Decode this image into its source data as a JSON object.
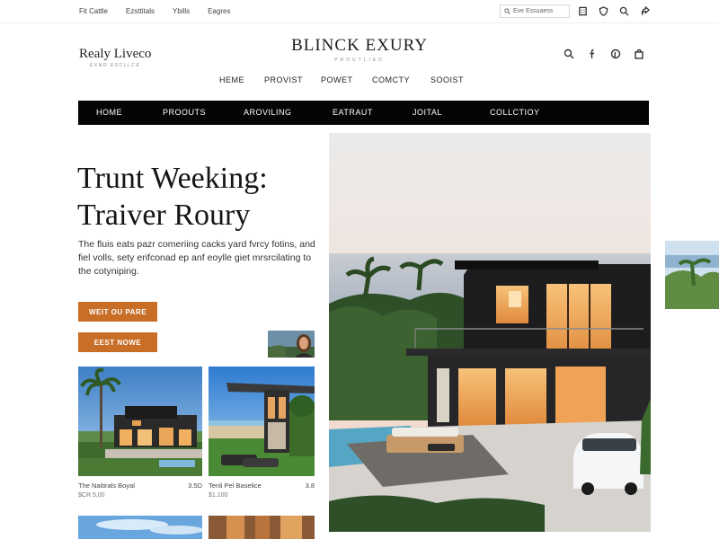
{
  "utility": {
    "links": [
      "Fit Cattle",
      "Ezsttitals",
      "Ybills",
      "Eagres"
    ],
    "search_placeholder": "Eve Essuaess"
  },
  "logo_left": {
    "name": "Realy Liveco",
    "sub": "EXNO ESCLLCE"
  },
  "brand": {
    "title": "BLINCK EXURY",
    "sub": "PROUTLIED"
  },
  "secondary_nav": [
    "HEME",
    "PROVIST",
    "POWET",
    "COMCTY",
    "SOOIST"
  ],
  "main_nav": [
    "HOME",
    "PROOUTS",
    "AROVILING",
    "EATRAUT",
    "JOITAL",
    "COLLCTIOY"
  ],
  "hero": {
    "title_line1": "Trunt Weeking:",
    "title_line2": "Traiver Roury",
    "desc": "The fluis eats pazr comeriing cacks yard fvrcy fotins, and fiel volls, sety erifconad ep anf eoylle giet mrsrcilating to the cotyniping.",
    "btn_primary": "WEIT OU PARE",
    "btn_secondary": "EEST NOWE"
  },
  "cards": [
    {
      "title": "The Naitirals Boyal",
      "rating": "3.5D",
      "price": "$CR 5,00"
    },
    {
      "title": "Tenli Pel Baselice",
      "rating": "3.8",
      "price": "$1.100"
    }
  ],
  "colors": {
    "accent": "#c96e27",
    "nav_bg": "#050505"
  }
}
